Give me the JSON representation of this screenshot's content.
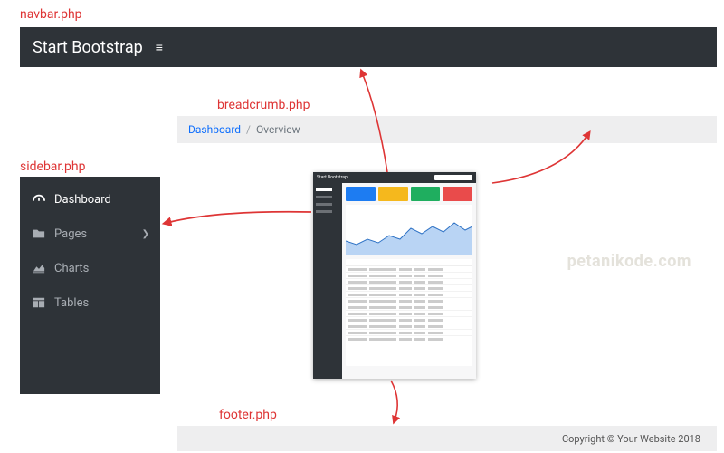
{
  "annotations": {
    "navbar": "navbar.php",
    "breadcrumb": "breadcrumb.php",
    "sidebar": "sidebar.php",
    "footer": "footer.php"
  },
  "navbar": {
    "brand": "Start Bootstrap"
  },
  "breadcrumb": {
    "link": "Dashboard",
    "sep": "/",
    "current": "Overview"
  },
  "sidebar": {
    "items": [
      {
        "label": "Dashboard",
        "active": true,
        "expandable": false
      },
      {
        "label": "Pages",
        "active": false,
        "expandable": true
      },
      {
        "label": "Charts",
        "active": false,
        "expandable": false
      },
      {
        "label": "Tables",
        "active": false,
        "expandable": false
      }
    ]
  },
  "thumb": {
    "brand": "Start Bootstrap"
  },
  "footer": {
    "text": "Copyright © Your Website 2018"
  },
  "watermark": "petanikode.com",
  "chart_data": {
    "type": "area",
    "note": "Decorative thumbnail area chart inside central screenshot; values are illustrative only, not labeled in source.",
    "x": [
      0,
      1,
      2,
      3,
      4,
      5,
      6,
      7,
      8,
      9,
      10,
      11,
      12
    ],
    "values": [
      28,
      22,
      30,
      24,
      34,
      30,
      42,
      36,
      44,
      38,
      48,
      40,
      46
    ],
    "ylim": [
      0,
      60
    ],
    "fill": "#b9d4f4",
    "stroke": "#2e72c5"
  }
}
